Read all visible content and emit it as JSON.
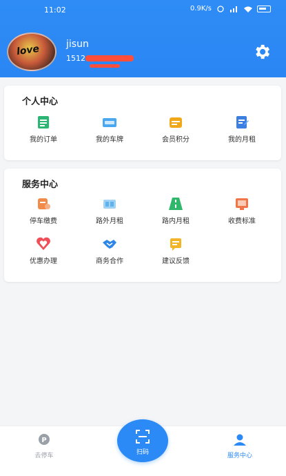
{
  "status_bar": {
    "time": "11:02",
    "network": "0.9K/s"
  },
  "profile": {
    "username": "jisun",
    "phone": "1512"
  },
  "personal_center": {
    "title": "个人中心",
    "items": [
      {
        "label": "我的订单",
        "icon": "order-icon",
        "color": "#2bb673"
      },
      {
        "label": "我的车牌",
        "icon": "license-plate-icon",
        "color": "#4aa8f0"
      },
      {
        "label": "会员积分",
        "icon": "points-icon",
        "color": "#f0a818"
      },
      {
        "label": "我的月租",
        "icon": "monthly-rent-icon",
        "color": "#3d7fe0"
      }
    ]
  },
  "service_center": {
    "title": "服务中心",
    "items": [
      {
        "label": "停车缴费",
        "icon": "parking-pay-icon",
        "color": "#f28a4a"
      },
      {
        "label": "路外月租",
        "icon": "offroad-monthly-icon",
        "color": "#5fb2ea"
      },
      {
        "label": "路内月租",
        "icon": "onroad-monthly-icon",
        "color": "#2fb86b"
      },
      {
        "label": "收费标准",
        "icon": "fee-standard-icon",
        "color": "#f0764a"
      },
      {
        "label": "优惠办理",
        "icon": "discount-icon",
        "color": "#ef4f58"
      },
      {
        "label": "商务合作",
        "icon": "handshake-icon",
        "color": "#2e86e6"
      },
      {
        "label": "建议反馈",
        "icon": "feedback-icon",
        "color": "#f2b527"
      }
    ]
  },
  "tab_bar": {
    "left": {
      "label": "去停车",
      "icon": "parking-icon"
    },
    "center": {
      "label": "扫码",
      "icon": "scan-icon"
    },
    "right": {
      "label": "服务中心",
      "icon": "user-icon"
    }
  },
  "colors": {
    "primary": "#2b8af5",
    "background": "#f4f5f7"
  }
}
